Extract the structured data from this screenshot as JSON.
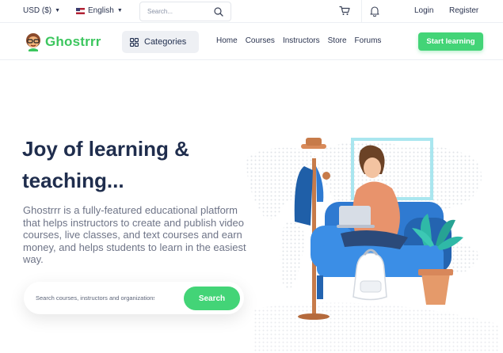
{
  "topbar": {
    "currency": "USD ($)",
    "language": "English",
    "search_placeholder": "Search...",
    "login": "Login",
    "register": "Register"
  },
  "nav": {
    "logo_text": "Ghostrrr",
    "categories_label": "Categories",
    "links": [
      "Home",
      "Courses",
      "Instructors",
      "Store",
      "Forums"
    ],
    "cta": "Start learning"
  },
  "hero": {
    "title_line1": "Joy of learning &",
    "title_line2": "teaching...",
    "description": "Ghostrrr is a fully-featured educational platform that helps instructors to create and publish video courses, live classes, and text courses and earn money, and helps students to learn in the easiest way.",
    "search_placeholder": "Search courses, instructors and organizations...",
    "search_button": "Search"
  },
  "colors": {
    "brand_green": "#43d477",
    "logo_green": "#3cc65e",
    "title_navy": "#1f2d4d",
    "body_gray": "#6e7487"
  },
  "icons": [
    "search-icon",
    "cart-icon",
    "bell-icon",
    "grid-icon",
    "chevron-down-icon",
    "flag-us-icon",
    "logo-mascot-icon"
  ]
}
